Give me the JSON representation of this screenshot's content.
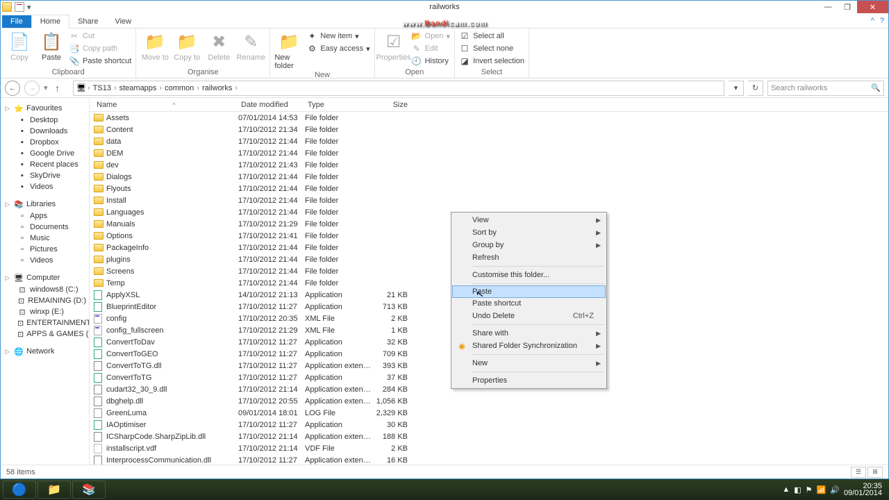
{
  "window": {
    "title": "railworks",
    "minimize": "—",
    "maximize": "❐",
    "close": "✕"
  },
  "tabs": {
    "file": "File",
    "home": "Home",
    "share": "Share",
    "view": "View"
  },
  "ribbon": {
    "clipboard": {
      "copy": "Copy",
      "paste": "Paste",
      "cut": "Cut",
      "copy_path": "Copy path",
      "paste_shortcut": "Paste shortcut",
      "label": "Clipboard"
    },
    "organise": {
      "move_to": "Move to",
      "copy_to": "Copy to",
      "delete": "Delete",
      "rename": "Rename",
      "label": "Organise"
    },
    "new": {
      "new_folder": "New folder",
      "new_item": "New item",
      "easy_access": "Easy access",
      "label": "New"
    },
    "open": {
      "properties": "Properties",
      "open": "Open",
      "edit": "Edit",
      "history": "History",
      "label": "Open"
    },
    "select": {
      "select_all": "Select all",
      "select_none": "Select none",
      "invert": "Invert selection",
      "label": "Select"
    }
  },
  "breadcrumbs": [
    "TS13",
    "steamapps",
    "common",
    "railworks"
  ],
  "search_placeholder": "Search railworks",
  "sidebar": {
    "favourites": "Favourites",
    "favourites_items": [
      "Desktop",
      "Downloads",
      "Dropbox",
      "Google Drive",
      "Recent places",
      "SkyDrive",
      "Videos"
    ],
    "libraries": "Libraries",
    "libraries_items": [
      "Apps",
      "Documents",
      "Music",
      "Pictures",
      "Videos"
    ],
    "computer": "Computer",
    "computer_items": [
      "windows8 (C:)",
      "REMAINING (D:)",
      "winxp (E:)",
      "ENTERTAINMENT",
      "APPS & GAMES (I:)"
    ],
    "network": "Network"
  },
  "columns": {
    "name": "Name",
    "date": "Date modified",
    "type": "Type",
    "size": "Size"
  },
  "files": [
    {
      "icon": "folder",
      "name": "Assets",
      "date": "07/01/2014 14:53",
      "type": "File folder",
      "size": ""
    },
    {
      "icon": "folder",
      "name": "Content",
      "date": "17/10/2012 21:34",
      "type": "File folder",
      "size": ""
    },
    {
      "icon": "folder",
      "name": "data",
      "date": "17/10/2012 21:44",
      "type": "File folder",
      "size": ""
    },
    {
      "icon": "folder",
      "name": "DEM",
      "date": "17/10/2012 21:44",
      "type": "File folder",
      "size": ""
    },
    {
      "icon": "folder",
      "name": "dev",
      "date": "17/10/2012 21:43",
      "type": "File folder",
      "size": ""
    },
    {
      "icon": "folder",
      "name": "Dialogs",
      "date": "17/10/2012 21:44",
      "type": "File folder",
      "size": ""
    },
    {
      "icon": "folder",
      "name": "Flyouts",
      "date": "17/10/2012 21:44",
      "type": "File folder",
      "size": ""
    },
    {
      "icon": "folder",
      "name": "Install",
      "date": "17/10/2012 21:44",
      "type": "File folder",
      "size": ""
    },
    {
      "icon": "folder",
      "name": "Languages",
      "date": "17/10/2012 21:44",
      "type": "File folder",
      "size": ""
    },
    {
      "icon": "folder",
      "name": "Manuals",
      "date": "17/10/2012 21:29",
      "type": "File folder",
      "size": ""
    },
    {
      "icon": "folder",
      "name": "Options",
      "date": "17/10/2012 21:41",
      "type": "File folder",
      "size": ""
    },
    {
      "icon": "folder",
      "name": "PackageInfo",
      "date": "17/10/2012 21:44",
      "type": "File folder",
      "size": ""
    },
    {
      "icon": "folder",
      "name": "plugins",
      "date": "17/10/2012 21:44",
      "type": "File folder",
      "size": ""
    },
    {
      "icon": "folder",
      "name": "Screens",
      "date": "17/10/2012 21:44",
      "type": "File folder",
      "size": ""
    },
    {
      "icon": "folder",
      "name": "Temp",
      "date": "17/10/2012 21:44",
      "type": "File folder",
      "size": ""
    },
    {
      "icon": "app",
      "name": "ApplyXSL",
      "date": "14/10/2012 21:13",
      "type": "Application",
      "size": "21 KB"
    },
    {
      "icon": "app",
      "name": "BlueprintEditor",
      "date": "17/10/2012 11:27",
      "type": "Application",
      "size": "713 KB"
    },
    {
      "icon": "xml",
      "name": "config",
      "date": "17/10/2012 20:35",
      "type": "XML File",
      "size": "2 KB"
    },
    {
      "icon": "xml",
      "name": "config_fullscreen",
      "date": "17/10/2012 21:29",
      "type": "XML File",
      "size": "1 KB"
    },
    {
      "icon": "app",
      "name": "ConvertToDav",
      "date": "17/10/2012 11:27",
      "type": "Application",
      "size": "32 KB"
    },
    {
      "icon": "app",
      "name": "ConvertToGEO",
      "date": "17/10/2012 11:27",
      "type": "Application",
      "size": "709 KB"
    },
    {
      "icon": "dll",
      "name": "ConvertToTG.dll",
      "date": "17/10/2012 11:27",
      "type": "Application extens...",
      "size": "393 KB"
    },
    {
      "icon": "app",
      "name": "ConvertToTG",
      "date": "17/10/2012 11:27",
      "type": "Application",
      "size": "37 KB"
    },
    {
      "icon": "dll",
      "name": "cudart32_30_9.dll",
      "date": "17/10/2012 21:14",
      "type": "Application extens...",
      "size": "284 KB"
    },
    {
      "icon": "dll",
      "name": "dbghelp.dll",
      "date": "17/10/2012 20:55",
      "type": "Application extens...",
      "size": "1,056 KB"
    },
    {
      "icon": "log",
      "name": "GreenLuma",
      "date": "09/01/2014 18:01",
      "type": "LOG File",
      "size": "2,329 KB"
    },
    {
      "icon": "app",
      "name": "IAOptimiser",
      "date": "17/10/2012 11:27",
      "type": "Application",
      "size": "30 KB"
    },
    {
      "icon": "dll",
      "name": "ICSharpCode.SharpZipLib.dll",
      "date": "17/10/2012 21:14",
      "type": "Application extens...",
      "size": "188 KB"
    },
    {
      "icon": "vdf",
      "name": "installscript.vdf",
      "date": "17/10/2012 21:14",
      "type": "VDF File",
      "size": "2 KB"
    },
    {
      "icon": "dll",
      "name": "InterprocessCommunication.dll",
      "date": "17/10/2012 11:27",
      "type": "Application extens...",
      "size": "16 KB"
    }
  ],
  "context_menu": {
    "view": "View",
    "sort_by": "Sort by",
    "group_by": "Group by",
    "refresh": "Refresh",
    "customise": "Customise this folder...",
    "paste": "Paste",
    "paste_shortcut": "Paste shortcut",
    "undo_delete": "Undo Delete",
    "undo_shortcut": "Ctrl+Z",
    "share_with": "Share with",
    "shared_sync": "Shared Folder Synchronization",
    "new": "New",
    "properties": "Properties"
  },
  "status": {
    "items": "58 items"
  },
  "taskbar": {
    "time": "20:35",
    "date": "09/01/2014"
  },
  "watermark": {
    "prefix": "www.",
    "brand": "Bandi",
    "suffix": "cam.com"
  }
}
